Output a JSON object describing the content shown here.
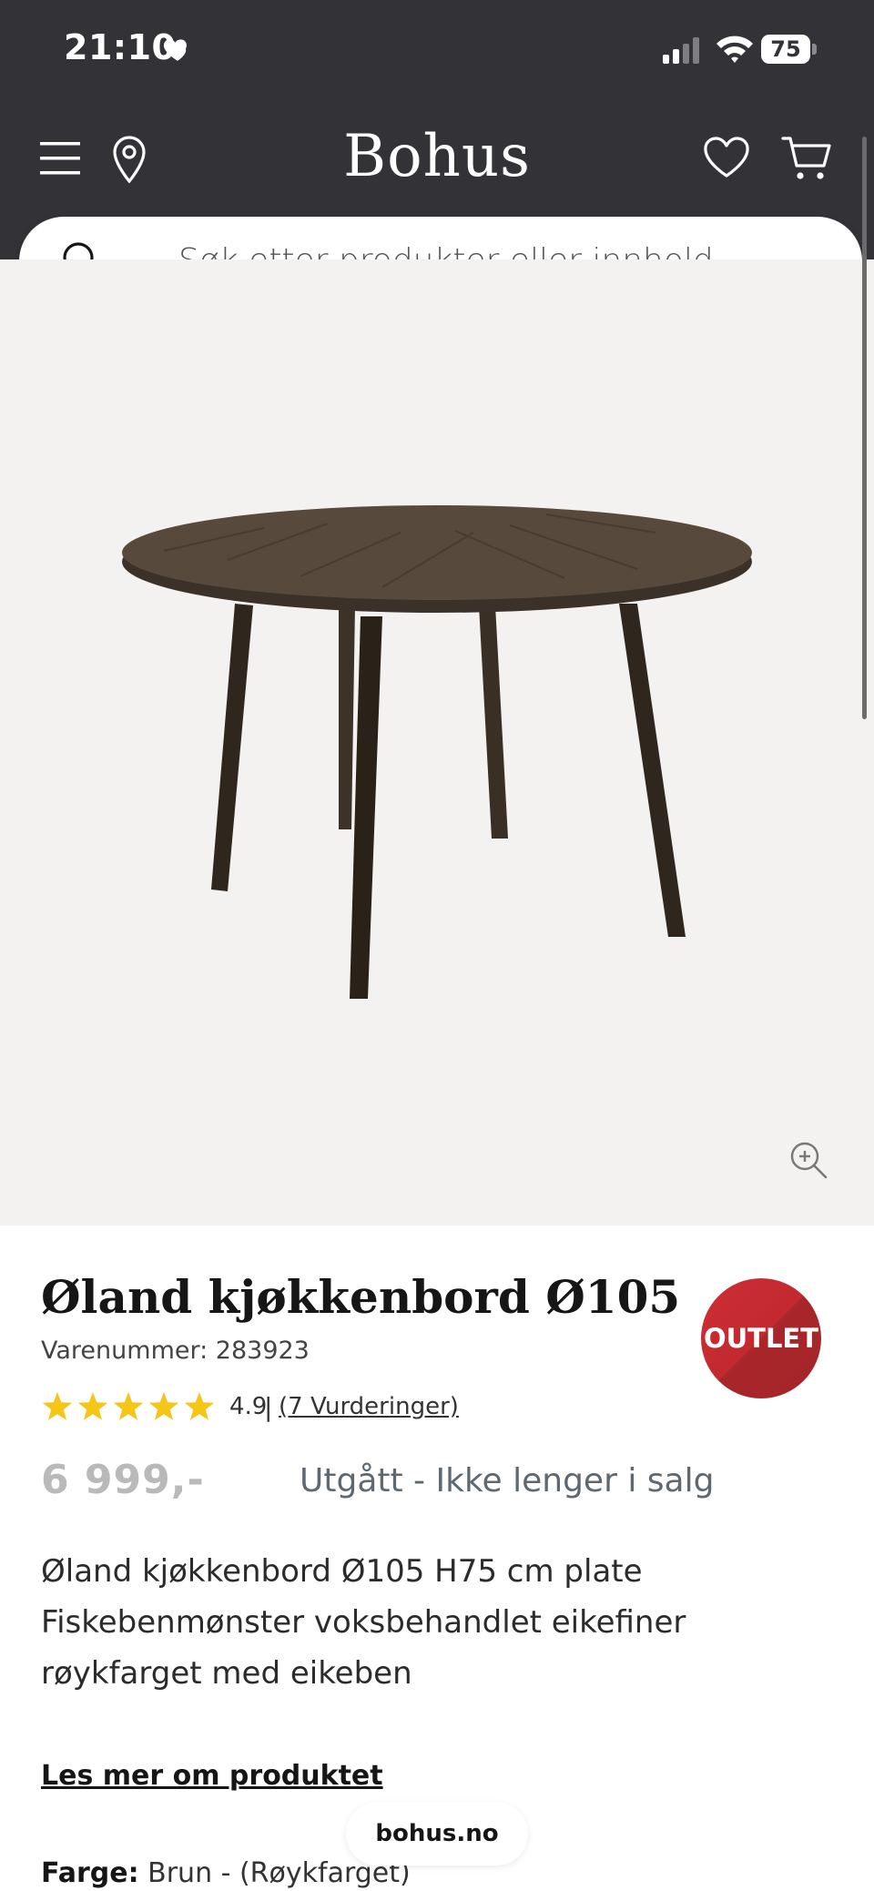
{
  "status_bar": {
    "time": "21:10",
    "battery": "75"
  },
  "header": {
    "brand": "Bohus"
  },
  "search": {
    "placeholder": "Søk etter produkter eller innhold..."
  },
  "product": {
    "title": "Øland kjøkkenbord Ø105",
    "sku": "Varenummer: 283923",
    "badge": "OUTLET",
    "rating_value": "4.9",
    "rating_separator": "|",
    "reviews_link": "(7 Vurderinger)",
    "stars_filled": 5,
    "stars_total": 5,
    "price": "6 999,-",
    "availability": "Utgått - Ikke lenger i salg",
    "description": "Øland kjøkkenbord Ø105 H75 cm plate Fiskebenmønster voksbehandlet eikefiner røykfarget med eikeben",
    "read_more": "Les mer om produktet",
    "color_label": "Farge:",
    "color_value": "Brun - (Røykfarget)"
  },
  "browser": {
    "url": "bohus.no"
  },
  "colors": {
    "header_bg": "#323237",
    "hero_bg": "#f4f2f0",
    "star": "#f5c518",
    "outlet_badge": "#c12a30",
    "table_wood": "#4a3f33"
  },
  "icons": [
    "heart-icon",
    "signal-icon",
    "wifi-icon",
    "battery-icon",
    "menu-icon",
    "location-pin-icon",
    "wishlist-heart-icon",
    "cart-icon",
    "search-icon",
    "zoom-in-icon",
    "star-icon"
  ]
}
